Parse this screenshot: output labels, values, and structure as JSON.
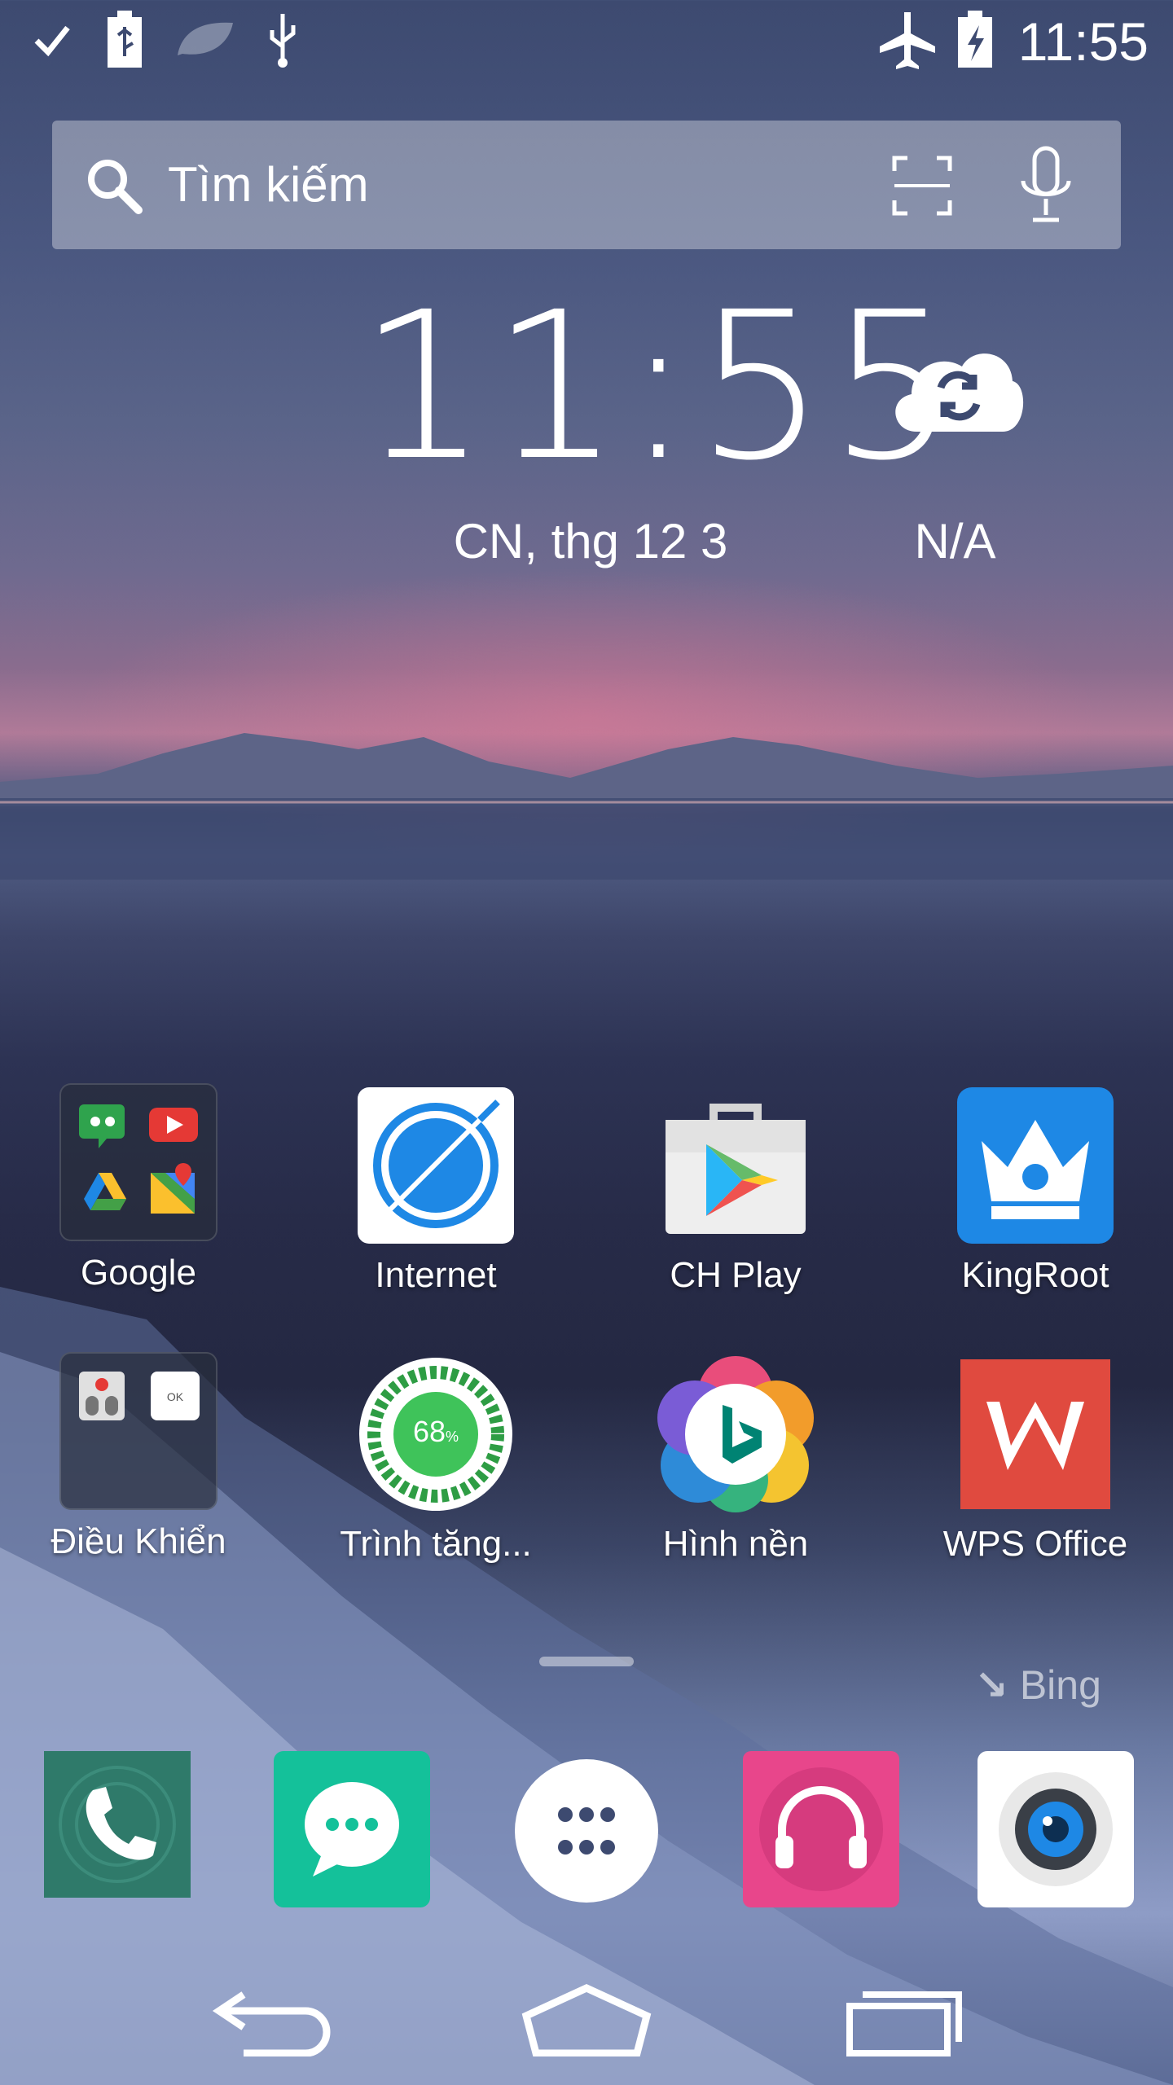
{
  "status_bar": {
    "left_icons": [
      "check-icon",
      "battery-usb-icon",
      "leaf-icon",
      "usb-icon"
    ],
    "right_icons": [
      "airplane-mode-icon",
      "battery-charging-icon"
    ],
    "time": "11:55"
  },
  "search": {
    "placeholder": "Tìm kiếm"
  },
  "clock_widget": {
    "time": "11:55",
    "date": "CN, thg 12 3",
    "weather": "N/A"
  },
  "apps": [
    {
      "label": "Google",
      "type": "folder"
    },
    {
      "label": "Internet"
    },
    {
      "label": "CH Play"
    },
    {
      "label": "KingRoot"
    },
    {
      "label": "Điều Khiển",
      "type": "folder"
    },
    {
      "label": "Trình tăng...",
      "badge": "68",
      "badge_unit": "%"
    },
    {
      "label": "Hình nền"
    },
    {
      "label": "WPS Office"
    }
  ],
  "bing_label": "Bing",
  "dock": [
    "phone-icon",
    "messages-icon",
    "app-drawer-icon",
    "music-icon",
    "camera-icon"
  ],
  "nav": [
    "back-icon",
    "home-icon",
    "recents-icon"
  ],
  "colors": {
    "kingroot": "#1e88e5",
    "wps": "#e04a3f",
    "messages": "#14c19a",
    "music": "#e8468b",
    "phone": "#2f7a6a"
  }
}
